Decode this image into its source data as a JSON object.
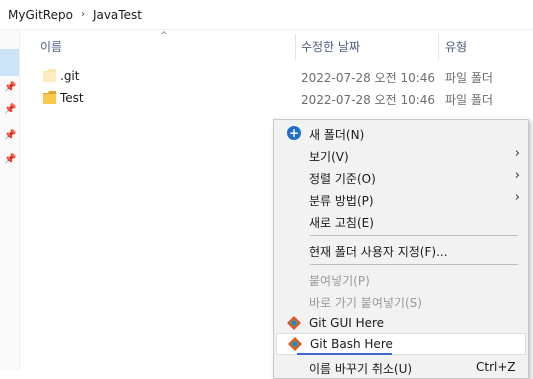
{
  "breadcrumb": {
    "items": [
      "MyGitRepo",
      "JavaTest"
    ],
    "separator": "›"
  },
  "columns": {
    "name": "이름",
    "modified": "수정한 날짜",
    "type": "유형"
  },
  "files": [
    {
      "name": ".git",
      "date": "2022-07-28 오전 10:46",
      "type": "파일 폴더",
      "icon": "folder-faded-icon"
    },
    {
      "name": "Test",
      "date": "2022-07-28 오전 10:46",
      "type": "파일 폴더",
      "icon": "folder-icon"
    }
  ],
  "context_menu": {
    "new_folder": "새 폴더(N)",
    "view": "보기(V)",
    "sort_by": "정렬 기준(O)",
    "group_by": "분류 방법(P)",
    "refresh": "새로 고침(E)",
    "customize": "현재 폴더 사용자 지정(F)...",
    "paste": "붙여넣기(P)",
    "paste_shortcut": "바로 가기 붙여넣기(S)",
    "git_gui": "Git GUI Here",
    "git_bash": "Git Bash Here",
    "undo_rename": "이름 바꾸기 취소(U)",
    "undo_shortcut": "Ctrl+Z"
  },
  "colors": {
    "accent": "#1f6fd1",
    "header_text": "#4d6082",
    "selection": "#cce4f7",
    "folder": "#f8c94a"
  }
}
